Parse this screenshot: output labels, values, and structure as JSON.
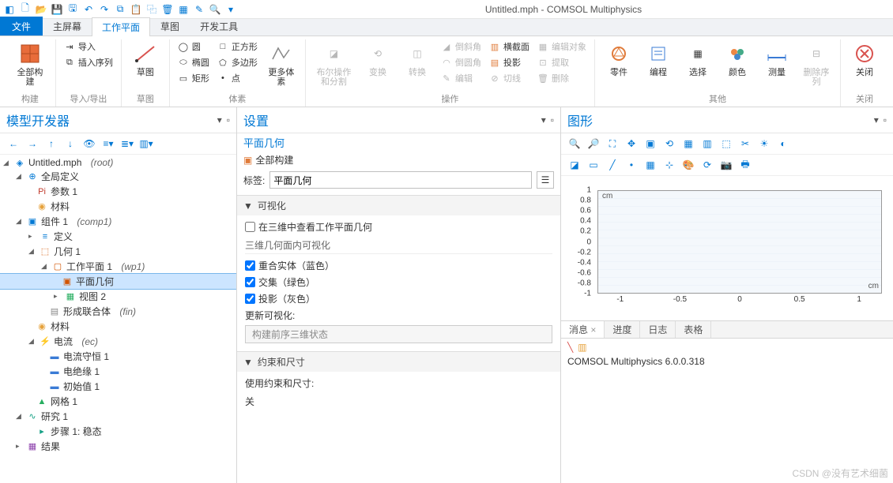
{
  "titlebar": {
    "title": "Untitled.mph - COMSOL Multiphysics"
  },
  "tabs": {
    "file": "文件",
    "home": "主屏幕",
    "workplane": "工作平面",
    "sketch": "草图",
    "dev": "开发工具"
  },
  "ribbon": {
    "build_all": "全部构建",
    "build_group": "构建",
    "import": "导入",
    "insert_seq": "插入序列",
    "io_group": "导入/导出",
    "sketch": "草图",
    "sketch_group": "草图",
    "circle": "圆",
    "square": "正方形",
    "ellipse": "椭圆",
    "polygon": "多边形",
    "rect": "矩形",
    "point": "点",
    "more_prims": "更多体素",
    "prims_group": "体素",
    "boolean": "布尔操作和分割",
    "transform": "变换",
    "convert": "转换",
    "chamfer": "倒斜角",
    "fillet": "倒圆角",
    "edit": "编辑",
    "cross_section": "横截面",
    "projection": "投影",
    "tangent": "切线",
    "edit_obj": "编辑对象",
    "extract": "提取",
    "delete": "删除",
    "ops_group": "操作",
    "parts": "零件",
    "program": "编程",
    "select": "选择",
    "color": "颜色",
    "measure": "测量",
    "del_seq": "删除序列",
    "other_group": "其他",
    "close": "关闭",
    "close_group": "关闭"
  },
  "tree_panel": {
    "title": "模型开发器"
  },
  "tree": {
    "root": "Untitled.mph",
    "root_suffix": "(root)",
    "global": "全局定义",
    "params": "参数 1",
    "materials": "材料",
    "comp": "组件 1",
    "comp_suffix": "(comp1)",
    "defs": "定义",
    "geom": "几何 1",
    "wp": "工作平面 1",
    "wp_suffix": "(wp1)",
    "plane_geom": "平面几何",
    "view2": "视图 2",
    "form_union": "形成联合体",
    "form_union_suffix": "(fin)",
    "materials2": "材料",
    "current": "电流",
    "current_suffix": "(ec)",
    "cc": "电流守恒 1",
    "ins": "电绝缘 1",
    "init": "初始值 1",
    "mesh": "网格 1",
    "study": "研究 1",
    "step": "步骤 1: 稳态",
    "results": "结果"
  },
  "settings": {
    "title": "设置",
    "subtitle": "平面几何",
    "build_all": "全部构建",
    "label_lbl": "标签:",
    "label_val": "平面几何",
    "sec_vis": "可视化",
    "view_in_3d": "在三维中查看工作平面几何",
    "vis_sub": "三维几何面内可视化",
    "coincident": "重合实体（蓝色）",
    "intersect": "交集（绿色）",
    "projection": "投影（灰色）",
    "update_vis": "更新可视化:",
    "update_btn": "构建前序三维状态",
    "sec_constraints": "约束和尺寸",
    "use_constraints": "使用约束和尺寸:",
    "use_val": "关"
  },
  "graphics": {
    "title": "图形",
    "unit": "cm",
    "yticks": [
      "1",
      "0.8",
      "0.6",
      "0.4",
      "0.2",
      "0",
      "-0.2",
      "-0.4",
      "-0.6",
      "-0.8",
      "-1"
    ],
    "xticks": [
      "-1",
      "-0.5",
      "0",
      "0.5",
      "1"
    ]
  },
  "bottom": {
    "msg": "消息",
    "progress": "进度",
    "log": "日志",
    "table": "表格",
    "version": "COMSOL Multiphysics 6.0.0.318"
  },
  "watermark": "CSDN @没有艺术细菌"
}
